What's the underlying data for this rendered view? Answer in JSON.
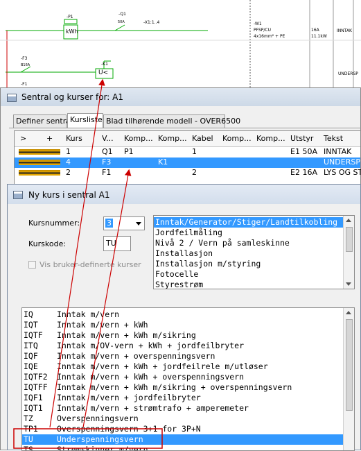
{
  "schematic": {
    "p1_label": "-P1",
    "p1_box": "kWh",
    "q1_label": "-Q1",
    "q1_small": "50A",
    "x1_label": "-X1:1..4",
    "w1_label": "-W1",
    "w1_type": "PFSP/CU",
    "w1_size": "4x16mm² + PE",
    "rating_a": "16A",
    "rating_kw": "11.1kW",
    "inntak": "INNTAK",
    "undersp": "UNDERSP",
    "f3_label": "-F3",
    "f3_small": "B16A",
    "k1_label": "-K1",
    "k1_box": "U<",
    "f1_label": "-F1"
  },
  "window1": {
    "title": "Sentral og kurser for: A1",
    "tabs": [
      "Definer sentral",
      "Kursliste",
      "Blad tilhørende modell - OVER6500"
    ],
    "columns": [
      ">",
      "+",
      "Kurs",
      "V...",
      "Komp...",
      "Komp...",
      "Kabel",
      "Komp...",
      "Komp...",
      "Utstyr",
      "Tekst"
    ],
    "rows": [
      {
        "kurs": "1",
        "v": "Q1",
        "komp1": "P1",
        "komp2": "",
        "kabel": "1",
        "utstyr": "E1 50A",
        "tekst": "INNTAK"
      },
      {
        "kurs": "4",
        "v": "F3",
        "komp1": "",
        "komp2": "K1",
        "kabel": "",
        "utstyr": "",
        "tekst": "UNDERSP"
      },
      {
        "kurs": "2",
        "v": "F1",
        "komp1": "",
        "komp2": "",
        "kabel": "2",
        "utstyr": "E2 16A",
        "tekst": "LYS OG ST"
      }
    ]
  },
  "window2": {
    "title": "Ny kurs i sentral  A1",
    "kursnummer_label": "Kursnummer:",
    "kursnummer_value": "3",
    "kurskode_label": "Kurskode:",
    "kurskode_value": "TU",
    "checkbox_label": "Vis bruker-definerte kurser",
    "categories": [
      "Inntak/Generator/Stiger/Landtilkobling",
      "Jordfeilmåling",
      "Nivå 2 / Vern på samleskinne",
      "Installasjon",
      "Installasjon m/styring",
      "Fotocelle",
      "Styrestrøm"
    ],
    "codes": [
      {
        "code": "IQ",
        "desc": "Inntak m/vern"
      },
      {
        "code": "IQT",
        "desc": "Inntak m/vern + kWh"
      },
      {
        "code": "IQTF",
        "desc": "Inntak m/vern + kWh m/sikring"
      },
      {
        "code": "ITQ",
        "desc": "Inntak m/OV-vern + kWh + jordfeilbryter"
      },
      {
        "code": "IQF",
        "desc": "Inntak m/vern + overspenningsvern"
      },
      {
        "code": "IQE",
        "desc": "Inntak m/vern + kWh + jordfeilrele m/utløser"
      },
      {
        "code": "IQTF2",
        "desc": "Inntak m/vern + kWh + overspenningsvern"
      },
      {
        "code": "IQTFF",
        "desc": "Inntak m/vern + kWh m/sikring + overspenningsvern"
      },
      {
        "code": "IQF1",
        "desc": "Inntak m/vern + jordfeilbryter"
      },
      {
        "code": "IQT1",
        "desc": "Inntak m/vern + strømtrafo + amperemeter"
      },
      {
        "code": "TZ",
        "desc": "Overspenningsvern"
      },
      {
        "code": "TP1",
        "desc": "Overspenningsvern 3+1 for 3P+N"
      },
      {
        "code": "TU",
        "desc": "Underspenningsvern"
      },
      {
        "code": "TS",
        "desc": "Strømskinner m/vern"
      }
    ]
  },
  "colors": {
    "selection": "#3399ff",
    "annotation": "#cc0000",
    "schematic_green": "#00aa00",
    "schematic_red": "#cc0000"
  }
}
